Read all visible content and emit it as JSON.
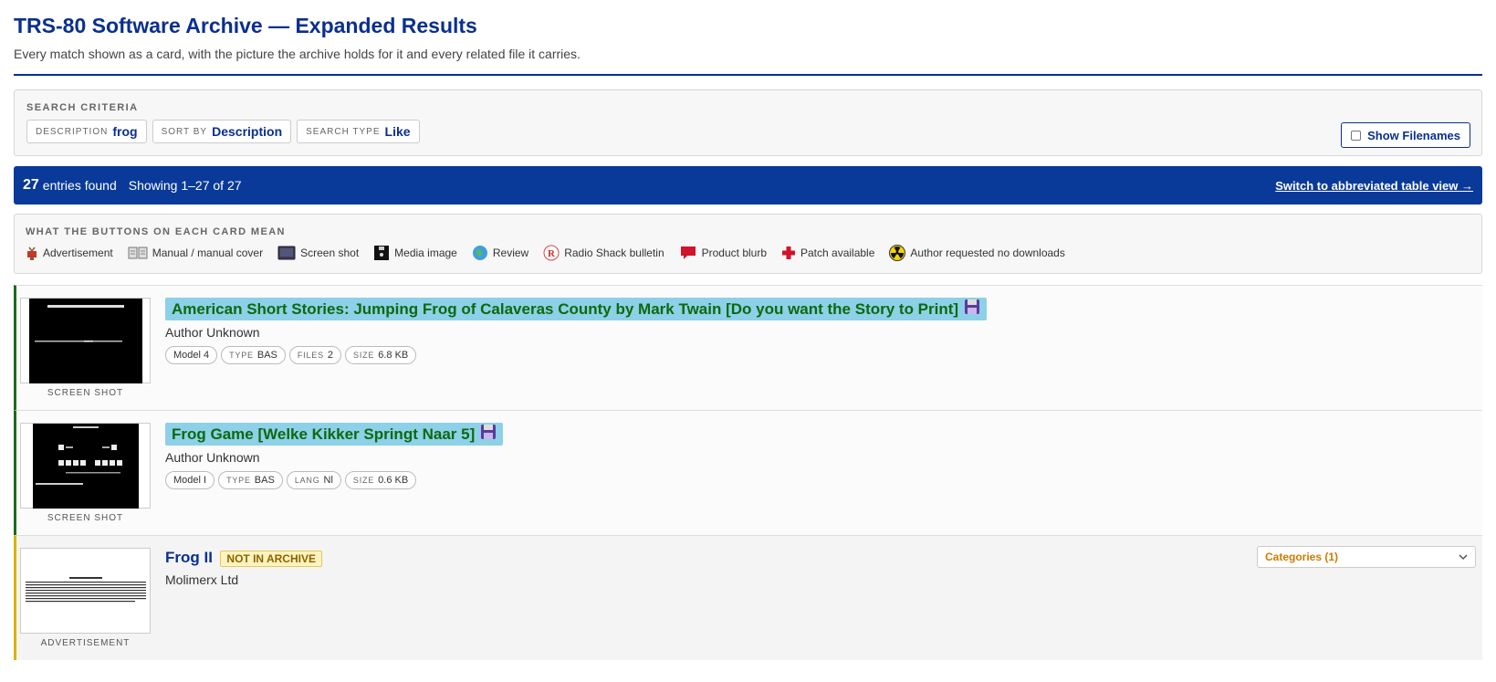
{
  "page": {
    "title": "TRS-80 Software Archive — Expanded Results",
    "subtitle": "Every match shown as a card, with the picture the archive holds for it and every related file it carries."
  },
  "criteria": {
    "label": "Search Criteria",
    "chips": [
      {
        "key": "Description",
        "value": "frog"
      },
      {
        "key": "Sort By",
        "value": "Description"
      },
      {
        "key": "Search Type",
        "value": "Like"
      }
    ],
    "show_filenames_label": "Show Filenames"
  },
  "results": {
    "count": "27",
    "count_label": "entries found",
    "showing": "Showing 1–27 of 27",
    "switch_label": "Switch to abbreviated table view →"
  },
  "legend": {
    "label": "What the buttons on each card mean",
    "items": [
      {
        "icon": "advertisement-icon",
        "label": "Advertisement"
      },
      {
        "icon": "manual-icon",
        "label": "Manual / manual cover"
      },
      {
        "icon": "screenshot-icon",
        "label": "Screen shot"
      },
      {
        "icon": "media-image-icon",
        "label": "Media image"
      },
      {
        "icon": "review-icon",
        "label": "Review"
      },
      {
        "icon": "radio-shack-icon",
        "label": "Radio Shack bulletin"
      },
      {
        "icon": "product-blurb-icon",
        "label": "Product blurb"
      },
      {
        "icon": "patch-icon",
        "label": "Patch available"
      },
      {
        "icon": "no-downloads-icon",
        "label": "Author requested no downloads"
      }
    ]
  },
  "entries": [
    {
      "title": "American Short Stories: Jumping Frog of Calaveras County by Mark Twain [Do you want the Story to Print]",
      "author": "Author Unknown",
      "thumb_caption": "Screen shot",
      "pills": [
        {
          "key": "",
          "value": "Model 4"
        },
        {
          "key": "Type",
          "value": "BAS"
        },
        {
          "key": "Files",
          "value": "2"
        },
        {
          "key": "Size",
          "value": "6.8 KB"
        }
      ]
    },
    {
      "title": "Frog Game [Welke Kikker Springt Naar 5]",
      "author": "Author Unknown",
      "thumb_caption": "Screen shot",
      "pills": [
        {
          "key": "",
          "value": "Model I"
        },
        {
          "key": "Type",
          "value": "BAS"
        },
        {
          "key": "Lang",
          "value": "Nl"
        },
        {
          "key": "Size",
          "value": "0.6 KB"
        }
      ]
    },
    {
      "title": "Frog II",
      "badge": "NOT IN ARCHIVE",
      "author": "Molimerx Ltd",
      "thumb_caption": "Advertisement",
      "categories_label": "Categories (1)"
    }
  ],
  "colors": {
    "brand": "#0a3a99",
    "title_blue": "#0a2f8f",
    "in_archive_green": "#1e6b1e",
    "highlight": "#8dd0e8",
    "not_archive_yellow": "#d8b300",
    "categories_orange": "#d07a00"
  }
}
